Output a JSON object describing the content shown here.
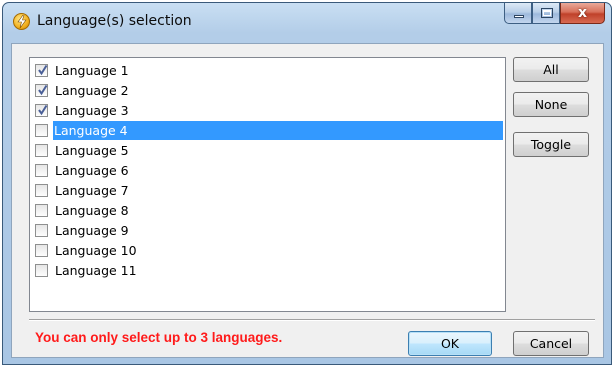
{
  "window": {
    "title": "Language(s) selection",
    "icon": "lightning-icon",
    "close_glyph": "x"
  },
  "list": {
    "items": [
      {
        "label": "Language 1",
        "checked": true,
        "selected": false
      },
      {
        "label": "Language 2",
        "checked": true,
        "selected": false
      },
      {
        "label": "Language 3",
        "checked": true,
        "selected": false
      },
      {
        "label": "Language 4",
        "checked": false,
        "selected": true
      },
      {
        "label": "Language 5",
        "checked": false,
        "selected": false
      },
      {
        "label": "Language 6",
        "checked": false,
        "selected": false
      },
      {
        "label": "Language 7",
        "checked": false,
        "selected": false
      },
      {
        "label": "Language 8",
        "checked": false,
        "selected": false
      },
      {
        "label": "Language 9",
        "checked": false,
        "selected": false
      },
      {
        "label": "Language 10",
        "checked": false,
        "selected": false
      },
      {
        "label": "Language 11",
        "checked": false,
        "selected": false
      }
    ]
  },
  "side_buttons": {
    "all": "All",
    "none": "None",
    "toggle": "Toggle"
  },
  "footer": {
    "warning": "You can only select up to 3 languages.",
    "ok": "OK",
    "cancel": "Cancel"
  },
  "colors": {
    "selection": "#3399ff",
    "warning": "#ff1a1a"
  }
}
